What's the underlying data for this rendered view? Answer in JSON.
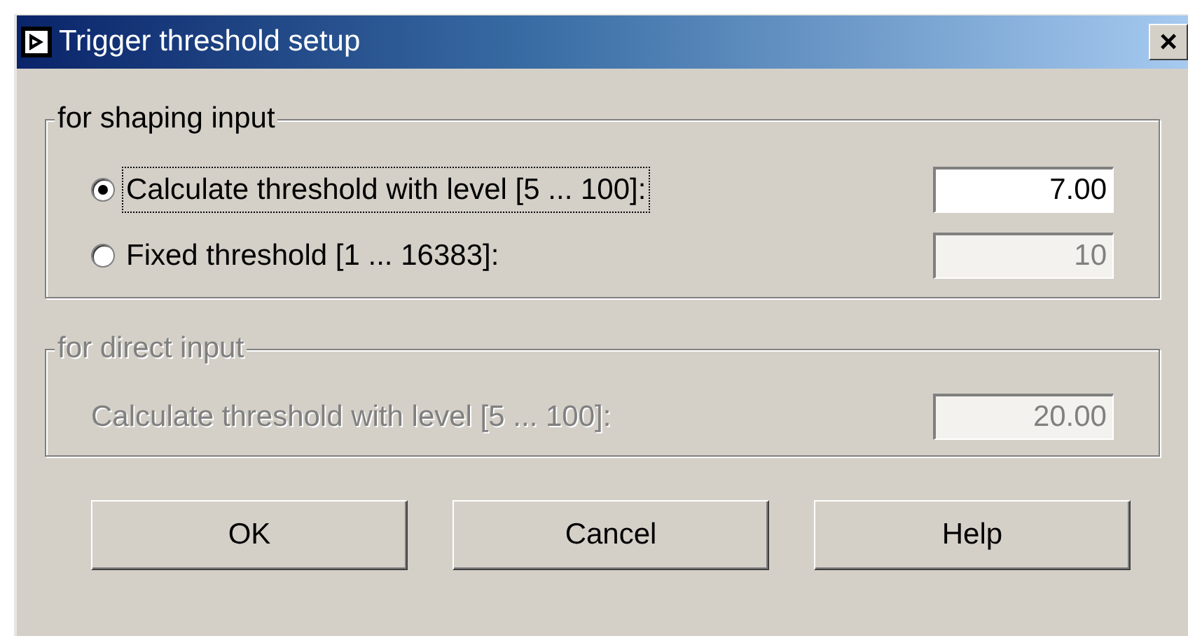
{
  "window": {
    "title": "Trigger threshold setup",
    "close": "×"
  },
  "groups": [
    {
      "title": "for shaping input",
      "disabled": false,
      "rows": [
        {
          "kind": "radio",
          "label": "Calculate threshold with level [5 ... 100]:",
          "selected": true,
          "focused": true,
          "value": "7.00",
          "disabled": false
        },
        {
          "kind": "radio",
          "label": "Fixed threshold [1 ... 16383]:",
          "selected": false,
          "focused": false,
          "value": "10",
          "disabled": true
        }
      ]
    },
    {
      "title": "for direct input",
      "disabled": true,
      "rows": [
        {
          "kind": "plain",
          "label": "Calculate threshold with level [5 ... 100]:",
          "value": "20.00",
          "disabled": true
        }
      ]
    }
  ],
  "buttons": [
    "OK",
    "Cancel",
    "Help"
  ]
}
